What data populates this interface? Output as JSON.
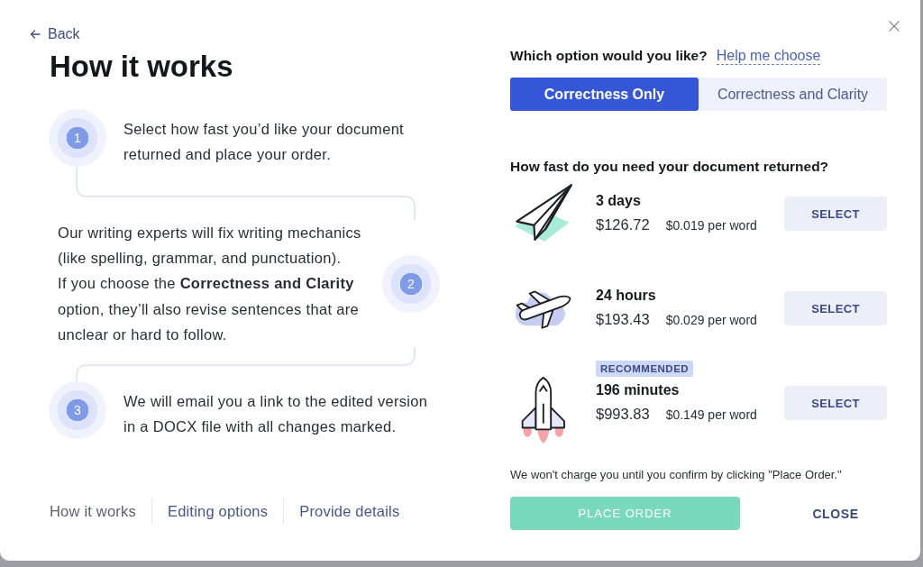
{
  "back_link": "Back",
  "title": "How it works",
  "steps": [
    {
      "number": "1",
      "paragraphs": [
        "Select how fast you’d like your document returned and place your order."
      ]
    },
    {
      "number": "2",
      "paragraphs": [
        "Our writing experts will fix writing mechanics (like spelling, grammar, and punctuation).",
        "If you choose the **Correctness and Clarity** option, they’ll also revise sentences that are unclear or hard to follow."
      ]
    },
    {
      "number": "3",
      "paragraphs": [
        "We will email you a link to the edited version in a DOCX file with all changes marked."
      ]
    }
  ],
  "nav": [
    {
      "label": "How it works",
      "selected": true
    },
    {
      "label": "Editing options",
      "selected": false
    },
    {
      "label": "Provide details",
      "selected": false
    }
  ],
  "option_question": "Which option would you like?",
  "help_link": "Help me choose",
  "options": [
    {
      "label": "Correctness Only",
      "selected": true
    },
    {
      "label": "Correctness and Clarity",
      "selected": false
    }
  ],
  "speed_question": "How fast do you need your document returned?",
  "turnarounds": [
    {
      "kind": "paper-plane",
      "title": "3 days",
      "price": "$126.72",
      "per_word": "$0.019 per word",
      "button": "SELECT"
    },
    {
      "kind": "airplane",
      "title": "24 hours",
      "price": "$193.43",
      "per_word": "$0.029 per word",
      "button": "SELECT"
    },
    {
      "kind": "rocket",
      "badge": "RECOMMENDED",
      "title": "196 minutes",
      "price": "$993.83",
      "per_word": "$0.149 per word",
      "button": "SELECT"
    }
  ],
  "note": "We won't charge you until you confirm by clicking \"Place Order.\"",
  "place_order": {
    "label": "PLACE ORDER",
    "disabled": true
  },
  "close_button": "CLOSE"
}
